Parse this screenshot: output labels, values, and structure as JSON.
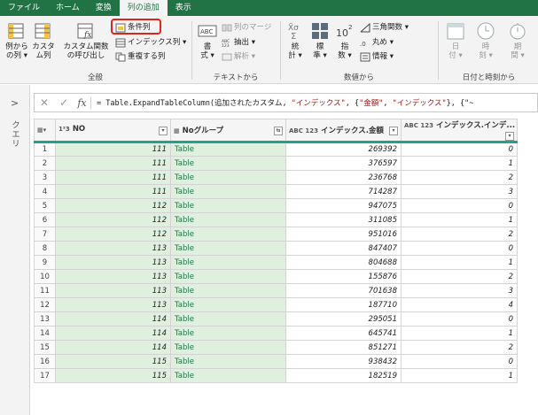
{
  "tabs": [
    "ファイル",
    "ホーム",
    "変換",
    "列の追加",
    "表示"
  ],
  "active_tab_index": 3,
  "ribbon": {
    "general": {
      "example_col_line1": "例から",
      "example_col_line2": "の列 ▾",
      "custom_col_line1": "カスタ",
      "custom_col_line2": "ム列",
      "invoke_fn_line1": "カスタム関数",
      "invoke_fn_line2": "の呼び出し",
      "conditional": "条件列",
      "index": "インデックス列 ▾",
      "duplicate": "重複する列",
      "label": "全般"
    },
    "text": {
      "format_line1": "書",
      "format_line2": "式 ▾",
      "merge": "列のマージ",
      "extract": "抽出 ▾",
      "parse": "解析 ▾",
      "label": "テキストから"
    },
    "number": {
      "stats_line1": "統",
      "stats_line2": "計 ▾",
      "standard_line1": "標",
      "standard_line2": "準 ▾",
      "scientific_line1": "指",
      "scientific_line2": "数 ▾",
      "trig": "三角関数 ▾",
      "round": "丸め ▾",
      "info": "情報 ▾",
      "label": "数値から"
    },
    "datetime": {
      "date_line1": "日",
      "date_line2": "付 ▾",
      "time_line1": "時",
      "time_line2": "刻 ▾",
      "duration_line1": "期",
      "duration_line2": "間 ▾",
      "label": "日付と時刻から"
    }
  },
  "left_pane": {
    "label": "クエリ"
  },
  "formula": {
    "prefix": "= Table.ExpandTableColumn(追加されたカスタム, ",
    "s1": "\"インデックス\"",
    "mid": ", {",
    "s2": "\"金額\"",
    "sep": ", ",
    "s3": "\"インデックス\"",
    "tail": "}, {\"~"
  },
  "columns": {
    "no": "NO",
    "group": "Noグループ",
    "amount": "インデックス.金額",
    "index": "インデックス.インデ..."
  },
  "rows": [
    {
      "rn": "1",
      "no": "111",
      "grp": "Table",
      "amt": "269392",
      "idx": "0"
    },
    {
      "rn": "2",
      "no": "111",
      "grp": "Table",
      "amt": "376597",
      "idx": "1"
    },
    {
      "rn": "3",
      "no": "111",
      "grp": "Table",
      "amt": "236768",
      "idx": "2"
    },
    {
      "rn": "4",
      "no": "111",
      "grp": "Table",
      "amt": "714287",
      "idx": "3"
    },
    {
      "rn": "5",
      "no": "112",
      "grp": "Table",
      "amt": "947075",
      "idx": "0"
    },
    {
      "rn": "6",
      "no": "112",
      "grp": "Table",
      "amt": "311085",
      "idx": "1"
    },
    {
      "rn": "7",
      "no": "112",
      "grp": "Table",
      "amt": "951016",
      "idx": "2"
    },
    {
      "rn": "8",
      "no": "113",
      "grp": "Table",
      "amt": "847407",
      "idx": "0"
    },
    {
      "rn": "9",
      "no": "113",
      "grp": "Table",
      "amt": "804688",
      "idx": "1"
    },
    {
      "rn": "10",
      "no": "113",
      "grp": "Table",
      "amt": "155876",
      "idx": "2"
    },
    {
      "rn": "11",
      "no": "113",
      "grp": "Table",
      "amt": "701638",
      "idx": "3"
    },
    {
      "rn": "12",
      "no": "113",
      "grp": "Table",
      "amt": "187710",
      "idx": "4"
    },
    {
      "rn": "13",
      "no": "114",
      "grp": "Table",
      "amt": "295051",
      "idx": "0"
    },
    {
      "rn": "14",
      "no": "114",
      "grp": "Table",
      "amt": "645741",
      "idx": "1"
    },
    {
      "rn": "15",
      "no": "114",
      "grp": "Table",
      "amt": "851271",
      "idx": "2"
    },
    {
      "rn": "16",
      "no": "115",
      "grp": "Table",
      "amt": "938432",
      "idx": "0"
    },
    {
      "rn": "17",
      "no": "115",
      "grp": "Table",
      "amt": "182519",
      "idx": "1"
    }
  ],
  "colors": {
    "brand": "#217346",
    "accent_teal": "#21a08a",
    "highlight_red": "#e0231b",
    "selected_col_bg": "#dff0df"
  }
}
